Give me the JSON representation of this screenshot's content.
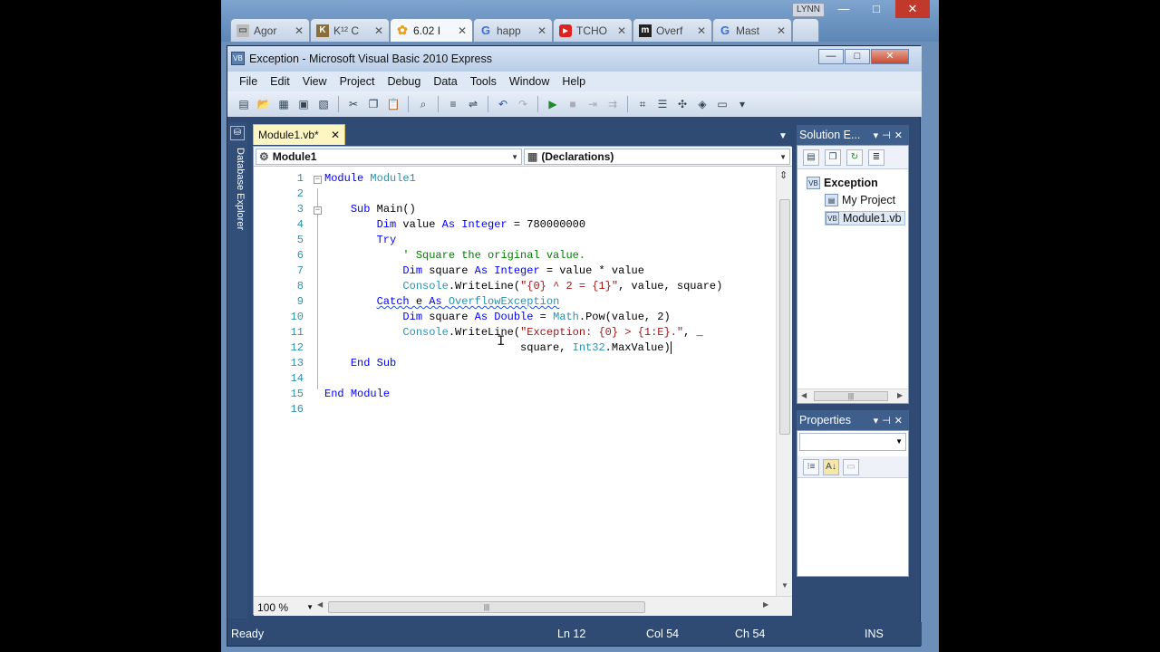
{
  "browser": {
    "tabs": [
      {
        "label": "Agor",
        "favicon": "doc-icon",
        "active": false
      },
      {
        "label": "K¹² C",
        "favicon": "k12-icon",
        "active": false
      },
      {
        "label": "6.02 I",
        "favicon": "flower-icon",
        "active": true
      },
      {
        "label": "happ",
        "favicon": "google-icon",
        "active": false
      },
      {
        "label": "TCHO",
        "favicon": "youtube-icon",
        "active": false
      },
      {
        "label": "Overf",
        "favicon": "m-icon",
        "active": false
      },
      {
        "label": "Mast",
        "favicon": "google-icon",
        "active": false
      }
    ],
    "user_label": "LYNN",
    "window_controls": {
      "minimize": "—",
      "maximize": "□",
      "close": "✕"
    }
  },
  "vs": {
    "title": "Exception - Microsoft Visual Basic 2010 Express",
    "title_controls": {
      "minimize": "—",
      "maximize": "□",
      "close": "✕"
    },
    "menu": [
      "File",
      "Edit",
      "View",
      "Project",
      "Debug",
      "Data",
      "Tools",
      "Window",
      "Help"
    ],
    "side_strip_label": "Database Explorer",
    "doc_tab": {
      "label": "Module1.vb*",
      "close": "✕"
    },
    "nav": {
      "left": "Module1",
      "right": "(Declarations)"
    },
    "code_lines": [
      {
        "n": "1",
        "text": "Module Module1"
      },
      {
        "n": "2",
        "text": ""
      },
      {
        "n": "3",
        "text": "    Sub Main()"
      },
      {
        "n": "4",
        "text": "        Dim value As Integer = 780000000"
      },
      {
        "n": "5",
        "text": "        Try"
      },
      {
        "n": "6",
        "text": "            ' Square the original value."
      },
      {
        "n": "7",
        "text": "            Dim square As Integer = value * value"
      },
      {
        "n": "8",
        "text": "            Console.WriteLine(\"{0} ^ 2 = {1}\", value, square)"
      },
      {
        "n": "9",
        "text": "        Catch e As OverflowException"
      },
      {
        "n": "10",
        "text": "            Dim square As Double = Math.Pow(value, 2)"
      },
      {
        "n": "11",
        "text": "            Console.WriteLine(\"Exception: {0} > {1:E}.\", _"
      },
      {
        "n": "12",
        "text": "                              square, Int32.MaxValue)"
      },
      {
        "n": "13",
        "text": "    End Sub"
      },
      {
        "n": "14",
        "text": ""
      },
      {
        "n": "15",
        "text": "End Module"
      },
      {
        "n": "16",
        "text": ""
      }
    ],
    "zoom": "100 %",
    "solution_explorer": {
      "title": "Solution E...",
      "items": [
        {
          "label": "Exception",
          "bold": true
        },
        {
          "label": "My Project",
          "bold": false
        },
        {
          "label": "Module1.vb",
          "bold": false
        }
      ]
    },
    "properties": {
      "title": "Properties"
    },
    "status": {
      "state": "Ready",
      "ln": "Ln 12",
      "col": "Col 54",
      "ch": "Ch 54",
      "mode": "INS"
    }
  }
}
